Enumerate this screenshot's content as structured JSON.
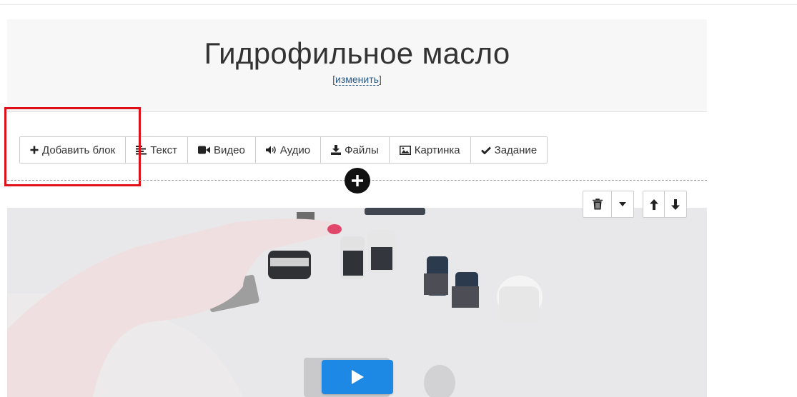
{
  "lesson": {
    "title": "Гидрофильное масло",
    "edit_open": "[",
    "edit_label": "изменить",
    "edit_close": "]"
  },
  "toolbar": {
    "items": [
      {
        "label": "Добавить блок",
        "icon": "plus-icon"
      },
      {
        "label": "Текст",
        "icon": "text-align-icon"
      },
      {
        "label": "Видео",
        "icon": "video-camera-icon"
      },
      {
        "label": "Аудио",
        "icon": "speaker-icon"
      },
      {
        "label": "Файлы",
        "icon": "download-icon"
      },
      {
        "label": "Картинка",
        "icon": "image-icon"
      },
      {
        "label": "Задание",
        "icon": "checkmark-icon"
      }
    ]
  },
  "block_controls": {
    "icons": [
      "trash-icon",
      "caret-down-icon",
      "arrow-up-icon",
      "arrow-down-icon"
    ]
  },
  "video": {
    "play_icon": "play-icon",
    "accent_color": "#1e88e5"
  },
  "colors": {
    "highlight": "#e0101a",
    "add_circle": "#111111"
  }
}
